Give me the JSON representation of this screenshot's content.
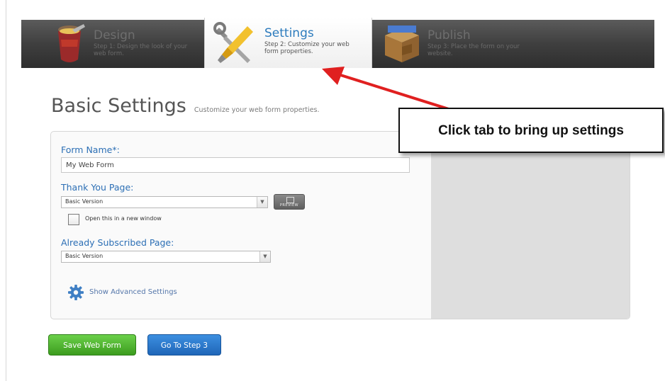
{
  "tabs": [
    {
      "title": "Design",
      "desc": "Step 1: Design the look of your web form.",
      "active": false
    },
    {
      "title": "Settings",
      "desc": "Step 2: Customize your web form properties.",
      "active": true
    },
    {
      "title": "Publish",
      "desc": "Step 3: Place the form on your website.",
      "active": false
    }
  ],
  "heading": {
    "title": "Basic Settings",
    "subtitle": "Customize your web form properties."
  },
  "form": {
    "form_name_label": "Form Name*:",
    "form_name_value": "My Web Form",
    "thank_you_label": "Thank You Page:",
    "thank_you_value": "Basic Version",
    "preview_label": "PREVIEW",
    "open_new_window_label": "Open this in a new window",
    "already_subscribed_label": "Already Subscribed Page:",
    "already_subscribed_value": "Basic Version",
    "advanced_link": "Show Advanced Settings"
  },
  "buttons": {
    "save": "Save Web Form",
    "next_step": "Go To Step 3"
  },
  "callout": {
    "text": "Click tab to bring up settings"
  },
  "colors": {
    "active_tab_title": "#2c7bbd",
    "label_blue": "#2c6fb5",
    "save_green": "#4fb52f",
    "step_blue": "#2a7bd0",
    "arrow_red": "#e02020"
  },
  "icons": {
    "design": "paint-bucket-icon",
    "settings": "wrench-screwdriver-icon",
    "publish": "shipping-box-icon",
    "advanced": "gear-icon"
  }
}
